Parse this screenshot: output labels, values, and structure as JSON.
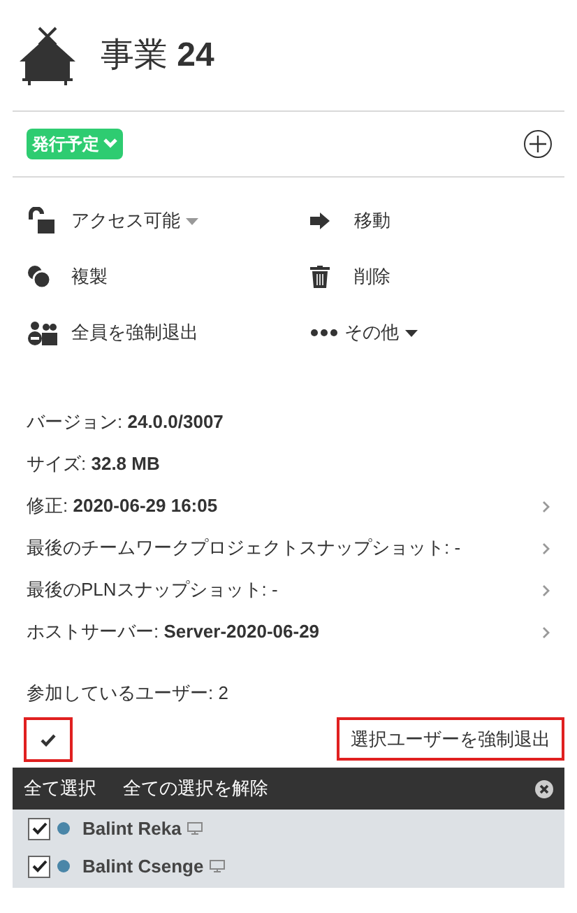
{
  "header": {
    "title_prefix": "事業",
    "title_number": "24"
  },
  "status_badge": {
    "label": "発行予定"
  },
  "actions": [
    {
      "kind": "access",
      "label": "アクセス可能",
      "dropdown": true
    },
    {
      "kind": "move",
      "label": "移動",
      "dropdown": false
    },
    {
      "kind": "copy",
      "label": "複製",
      "dropdown": false
    },
    {
      "kind": "delete",
      "label": "削除",
      "dropdown": false
    },
    {
      "kind": "kick",
      "label": "全員を強制退出",
      "dropdown": false
    },
    {
      "kind": "more",
      "label": "その他",
      "dropdown": true
    }
  ],
  "properties": [
    {
      "label": "バージョン: ",
      "value": "24.0.0/3007",
      "chevron": false
    },
    {
      "label": "サイズ: ",
      "value": "32.8 MB",
      "chevron": false
    },
    {
      "label": "修正: ",
      "value": "2020-06-29 16:05",
      "chevron": true
    },
    {
      "label": "最後のチームワークプロジェクトスナップショット: -",
      "chevron": true
    },
    {
      "label": "最後のPLNスナップショット: -",
      "chevron": true
    },
    {
      "label": "ホストサーバー: ",
      "value": "Server-2020-06-29",
      "chevron": true
    }
  ],
  "users_count": "参加しているユーザー: 2",
  "kick_selected_button": "選択ユーザーを強制退出",
  "selection_bar": {
    "select_all": "全て選択",
    "deselect_all": "全ての選択を解除"
  },
  "users": [
    {
      "name": "Balint Reka",
      "checked": true,
      "color": "#4a86a8"
    },
    {
      "name": "Balint Csenge",
      "checked": true,
      "color": "#4a86a8"
    }
  ]
}
